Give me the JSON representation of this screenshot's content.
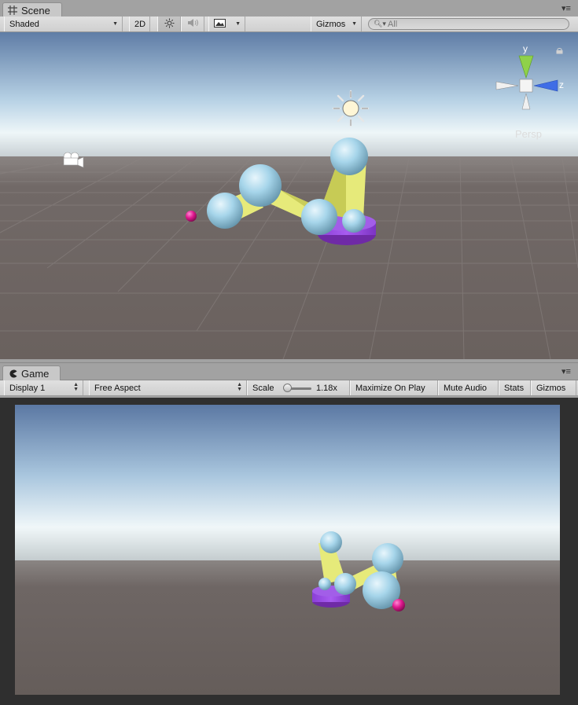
{
  "scene": {
    "tab_label": "Scene",
    "toolbar": {
      "draw_mode": "Shaded",
      "mode_2d": "2D",
      "gizmos": "Gizmos",
      "search_placeholder": "All"
    },
    "view_gizmo": {
      "axis_y": "y",
      "axis_z": "z",
      "projection": "Persp"
    }
  },
  "game": {
    "tab_label": "Game",
    "toolbar": {
      "display": "Display 1",
      "aspect": "Free Aspect",
      "scale_label": "Scale",
      "scale_value": "1.18x",
      "maximize": "Maximize On Play",
      "mute": "Mute Audio",
      "stats": "Stats",
      "gizmos": "Gizmos"
    }
  },
  "colors": {
    "sky_top": "#5f7da6",
    "horizon": "#e7f1f6",
    "ground": "#6c6360",
    "joint": "#9fd1e9",
    "link": "#e6ea7a",
    "base": "#9b4de0",
    "target": "#e0188f"
  },
  "icons": [
    "scene-grid-icon",
    "game-pacman-icon",
    "sun-light-icon",
    "audio-icon",
    "image-effects-icon",
    "camera-gizmo-icon",
    "directional-light-icon",
    "lock-icon",
    "panel-menu-icon"
  ]
}
